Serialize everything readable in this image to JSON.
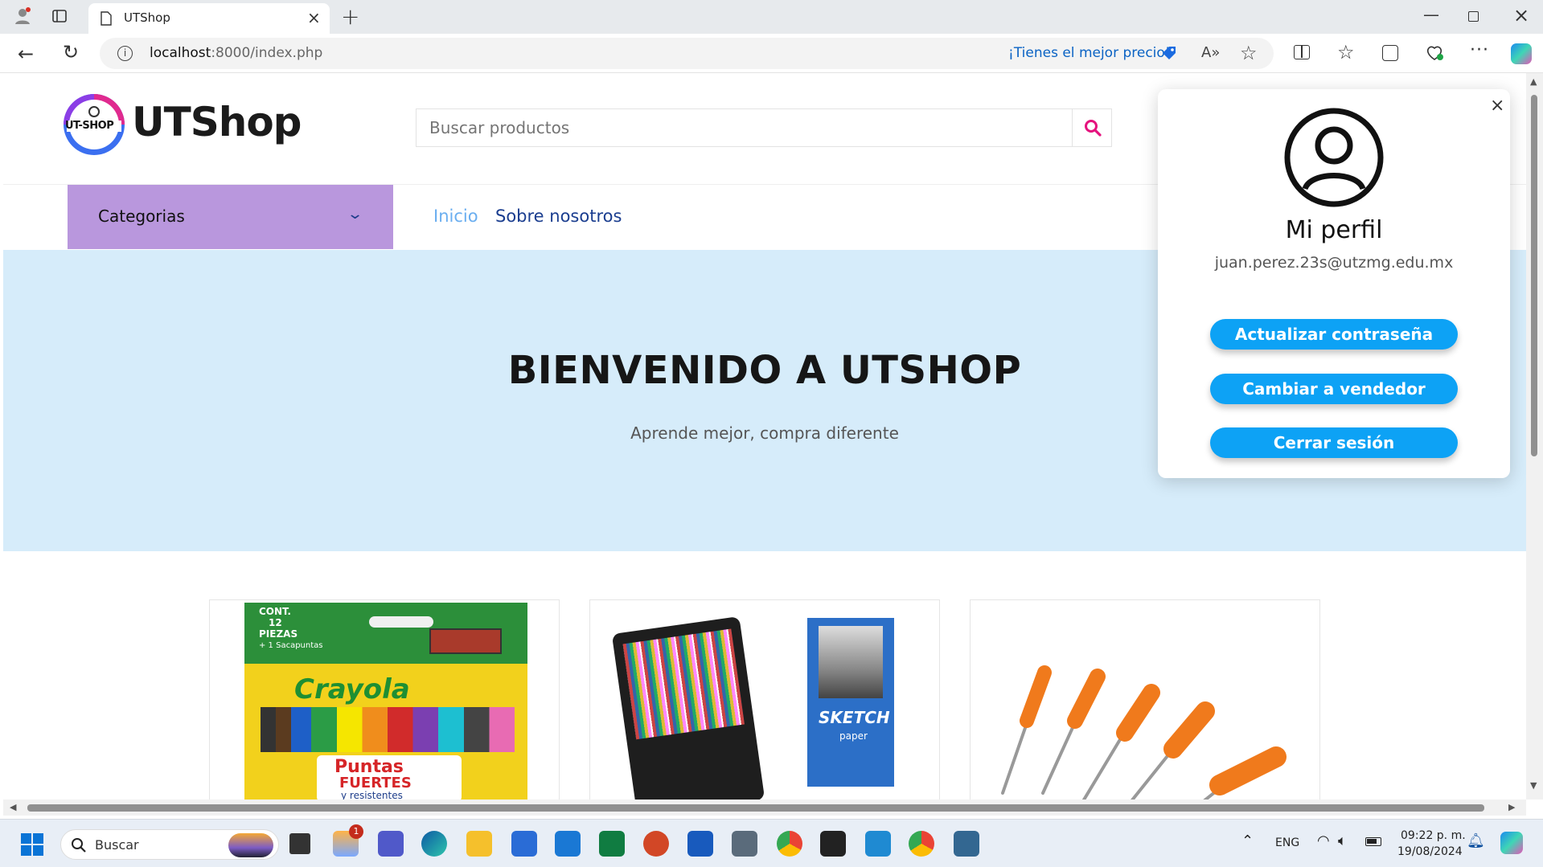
{
  "browser": {
    "tab_title": "UTShop",
    "url_host": "localhost",
    "url_path": ":8000/index.php",
    "price_promo": "¡Tienes el mejor precio!"
  },
  "site": {
    "brand": "UTShop",
    "logo_text": "UT-SHOP",
    "search_placeholder": "Buscar productos",
    "categories_label": "Categorias",
    "nav": [
      {
        "label": "Inicio"
      },
      {
        "label": "Sobre nosotros"
      }
    ],
    "hero_title": "BIENVENIDO A UTSHOP",
    "hero_subtitle": "Aprende mejor, compra diferente",
    "products": [
      {
        "name": "Crayola",
        "line1": "CONT.",
        "line2": "12",
        "line3": "PIEZAS",
        "line4": "+ 1 Sacapuntas",
        "badge": "Puntas",
        "badge2": "FUERTES",
        "badge3": "y resistentes"
      },
      {
        "name": "SKETCH",
        "subtitle": "paper"
      },
      {
        "name": "screwdrivers"
      }
    ]
  },
  "profile_panel": {
    "title": "Mi perfil",
    "email": "juan.perez.23s@utzmg.edu.mx",
    "close": "×",
    "buttons": [
      {
        "label": "Actualizar contraseña"
      },
      {
        "label": "Cambiar a vendedor"
      },
      {
        "label": "Cerrar sesión"
      }
    ]
  },
  "taskbar": {
    "search_label": "Buscar",
    "lang": "ENG",
    "time": "09:22 p. m.",
    "date": "19/08/2024",
    "weather_badge": "1"
  },
  "colors": {
    "accent_blue": "#0da2f5",
    "categories_bg": "#b997dd",
    "hero_bg": "#d6ecfa",
    "search_icon": "#e5127d"
  }
}
